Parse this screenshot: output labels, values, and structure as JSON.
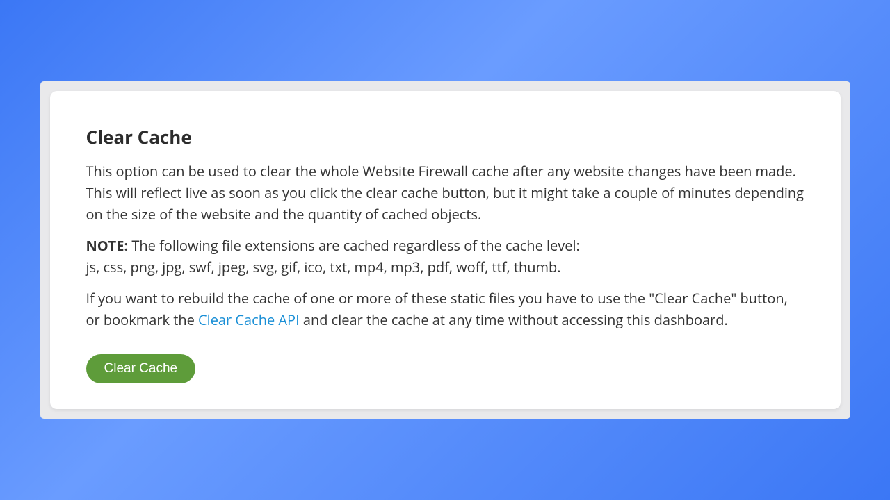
{
  "card": {
    "title": "Clear Cache",
    "description": "This option can be used to clear the whole Website Firewall cache after any website changes have been made. This will reflect live as soon as you click the clear cache button, but it might take a couple of minutes depending on the size of the website and the quantity of cached objects.",
    "note_label": "NOTE:",
    "note_text": " The following file extensions are cached regardless of the cache level:",
    "cached_extensions": "js, css, png, jpg, swf, jpeg, svg, gif, ico, txt, mp4, mp3, pdf, woff, ttf, thumb.",
    "rebuild_pre": "If you want to rebuild the cache of one or more of these static files you have to use the \"Clear Cache\" button, or bookmark the ",
    "api_link_text": "Clear Cache API",
    "rebuild_post": " and clear the cache at any time without accessing this dashboard.",
    "button_label": "Clear Cache"
  }
}
